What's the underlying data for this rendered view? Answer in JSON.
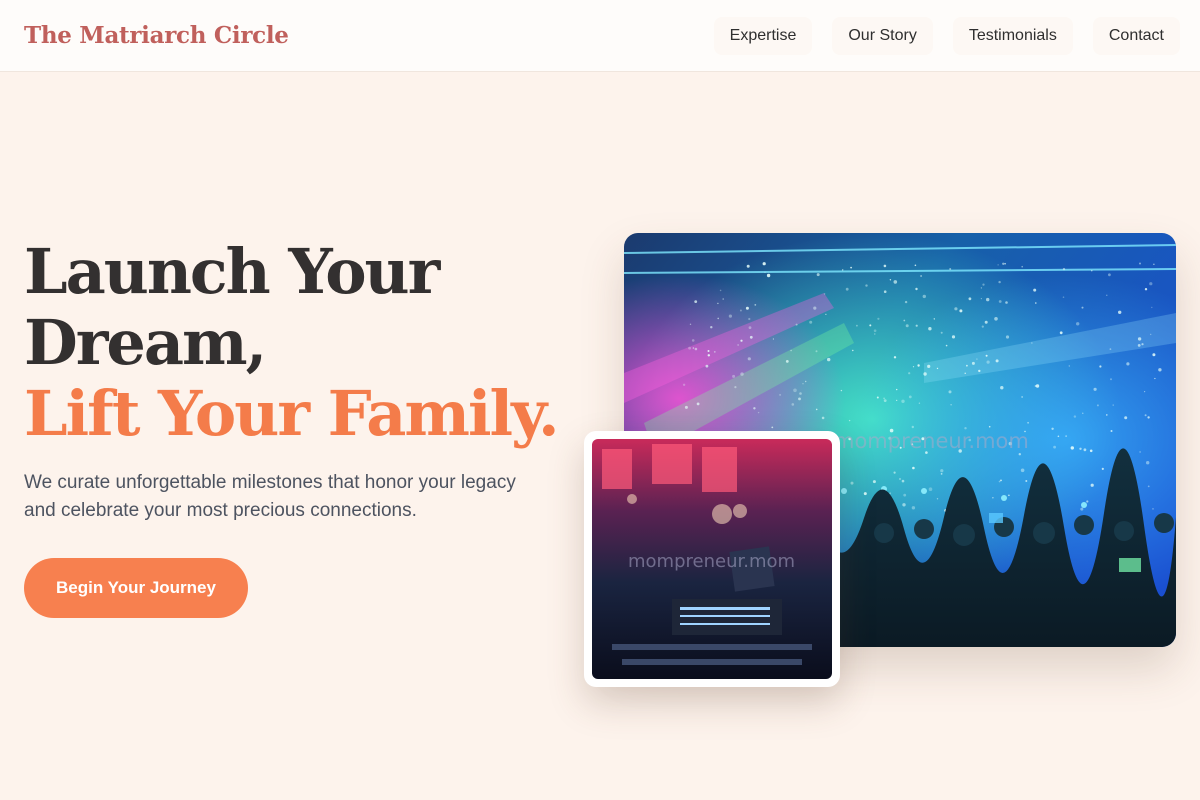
{
  "brand": {
    "name": "The Matriarch Circle"
  },
  "nav": {
    "items": [
      {
        "label": "Expertise"
      },
      {
        "label": "Our Story"
      },
      {
        "label": "Testimonials"
      },
      {
        "label": "Contact"
      }
    ]
  },
  "hero": {
    "headline_line1": "Launch Your",
    "headline_line2": "Dream,",
    "headline_accent": "Lift Your Family.",
    "subtitle": "We curate unforgettable milestones that honor your legacy and celebrate your most precious connections.",
    "cta_label": "Begin Your Journey"
  },
  "images": {
    "main": {
      "subject": "concert-crowd-stage-lights",
      "watermark": "mompreneur.mom"
    },
    "secondary": {
      "subject": "event-sound-mixer-console",
      "watermark": "mompreneur.mom"
    }
  },
  "colors": {
    "background": "#fdf3ec",
    "brand": "#c0605c",
    "accent": "#f47c4a",
    "heading": "#333030",
    "body_text": "#4d5360"
  }
}
